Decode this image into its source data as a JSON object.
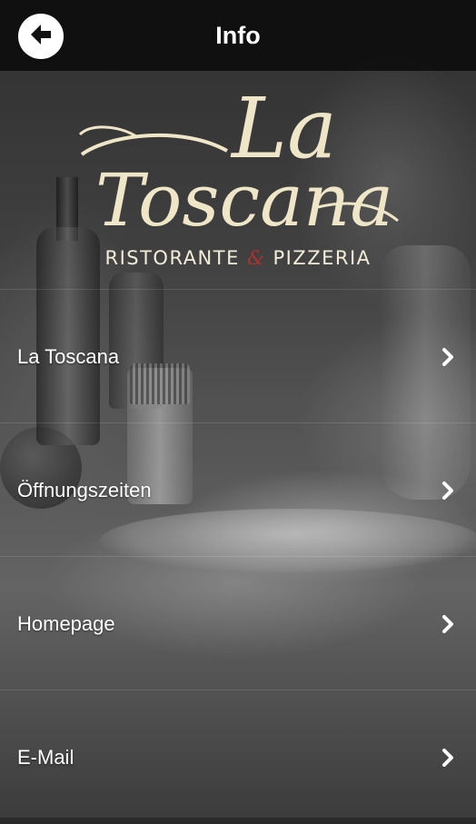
{
  "header": {
    "title": "Info",
    "back_icon": "arrow-left-icon"
  },
  "logo": {
    "line1": "La",
    "line2": "Toscana",
    "sub_left": "RISTORANTE",
    "sub_amp": "&",
    "sub_right": "PIZZERIA",
    "script_color": "#efe6c8",
    "amp_color": "#b0312d"
  },
  "menu": {
    "items": [
      {
        "label": "La Toscana",
        "icon": "chevron-right-icon"
      },
      {
        "label": "Öffnungszeiten",
        "icon": "chevron-right-icon"
      },
      {
        "label": "Homepage",
        "icon": "chevron-right-icon"
      },
      {
        "label": "E-Mail",
        "icon": "chevron-right-icon"
      }
    ]
  }
}
